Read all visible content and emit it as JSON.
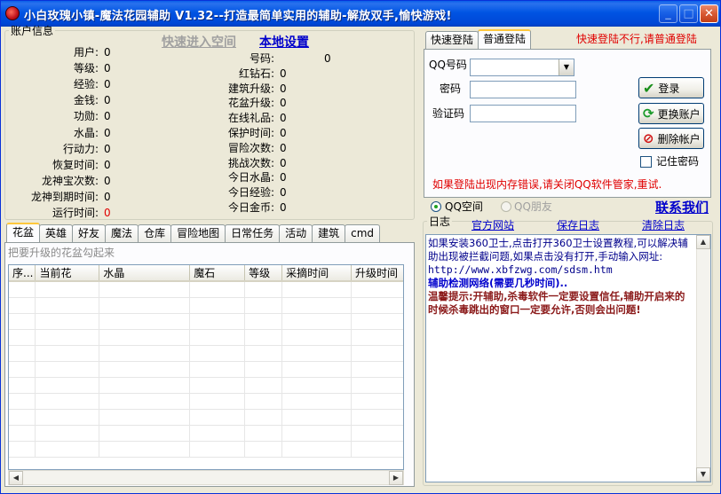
{
  "window": {
    "title": "小白玫瑰小镇-魔法花园辅助 V1.32--打造最简单实用的辅助-解放双手,愉快游戏!",
    "minimize": "_",
    "maximize": "□",
    "close": "✕"
  },
  "account": {
    "legend": "账户信息",
    "quick_enter": "快速进入空间",
    "local_settings": "本地设置",
    "left_fields": [
      {
        "label": "用户:",
        "value": "0"
      },
      {
        "label": "等级:",
        "value": "0"
      },
      {
        "label": "经验:",
        "value": "0"
      },
      {
        "label": "金钱:",
        "value": "0"
      },
      {
        "label": "功勋:",
        "value": "0"
      },
      {
        "label": "水晶:",
        "value": "0"
      },
      {
        "label": "行动力:",
        "value": "0"
      },
      {
        "label": "恢复时间:",
        "value": "0"
      },
      {
        "label": "龙神宝次数:",
        "value": "0"
      },
      {
        "label": "龙神到期时间:",
        "value": "0"
      },
      {
        "label": "运行时间:",
        "value": "0"
      }
    ],
    "right_fields": [
      {
        "label": "号码:",
        "value": "0"
      },
      {
        "label": "红钻石:",
        "value": "0"
      },
      {
        "label": "建筑升级:",
        "value": "0"
      },
      {
        "label": "花盆升级:",
        "value": "0"
      },
      {
        "label": "在线礼品:",
        "value": "0"
      },
      {
        "label": "保护时间:",
        "value": "0"
      },
      {
        "label": "冒险次数:",
        "value": "0"
      },
      {
        "label": "挑战次数:",
        "value": "0"
      },
      {
        "label": "今日水晶:",
        "value": "0"
      },
      {
        "label": "今日经验:",
        "value": "0"
      },
      {
        "label": "今日金币:",
        "value": "0"
      }
    ]
  },
  "login": {
    "tabs": [
      "快速登陆",
      "普通登陆"
    ],
    "notice": "快速登陆不行,请普通登陆",
    "qq_label": "QQ号码",
    "password_label": "密码",
    "captcha_label": "验证码",
    "login_button": "登录",
    "switch_button": "更换账户",
    "delete_button": "删除帐户",
    "remember_label": "记住密码",
    "error_tip": "如果登陆出现内存错误,请关闭QQ软件管家,重试.",
    "radio_qzone": "QQ空间",
    "radio_pengyou": "QQ朋友",
    "contact": "联系我们"
  },
  "log": {
    "title": "日志",
    "official_site": "官方网站",
    "save_log": "保存日志",
    "clear_log": "清除日志",
    "lines": [
      {
        "text": "如果安装360卫士,点击打开360卫士设置教程,可以解决辅助出现被拦截问题,如果点击没有打开,手动输入网址:",
        "color": "#00008b"
      },
      {
        "text": "http://www.xbfzwg.com/sdsm.htm",
        "color": "#00008b"
      },
      {
        "text": "辅助检测网络(需要几秒时间)..",
        "color": "#0000cc"
      },
      {
        "text": "温馨提示:开辅助,杀毒软件一定要设置信任,辅助开启来的时候杀毒跳出的窗口一定要允许,否则会出问题!",
        "color": "#8b1a1a"
      }
    ]
  },
  "main_tabs": [
    "花盆",
    "英雄",
    "好友",
    "魔法",
    "仓库",
    "冒险地图",
    "日常任务",
    "活动",
    "建筑",
    "cmd"
  ],
  "flowerpot": {
    "hint": "把要升级的花盆勾起来",
    "columns": [
      "序...",
      "当前花",
      "水晶",
      "魔石",
      "等级",
      "采摘时间",
      "升级时间"
    ]
  }
}
